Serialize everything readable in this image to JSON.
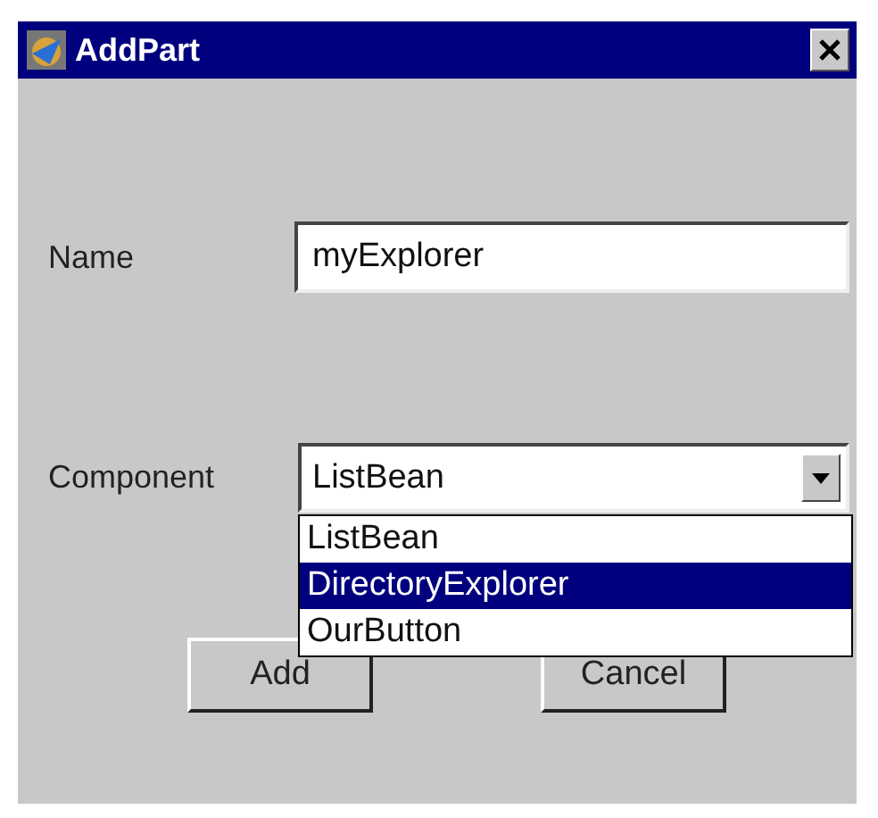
{
  "window": {
    "title": "AddPart"
  },
  "name_field": {
    "label": "Name",
    "value": "myExplorer"
  },
  "component_field": {
    "label": "Component",
    "value": "ListBean",
    "expanded": true,
    "options": [
      {
        "label": "ListBean",
        "highlighted": false
      },
      {
        "label": "DirectoryExplorer",
        "highlighted": true
      },
      {
        "label": "OurButton",
        "highlighted": false
      }
    ]
  },
  "buttons": [
    "Add",
    "Cancel"
  ]
}
